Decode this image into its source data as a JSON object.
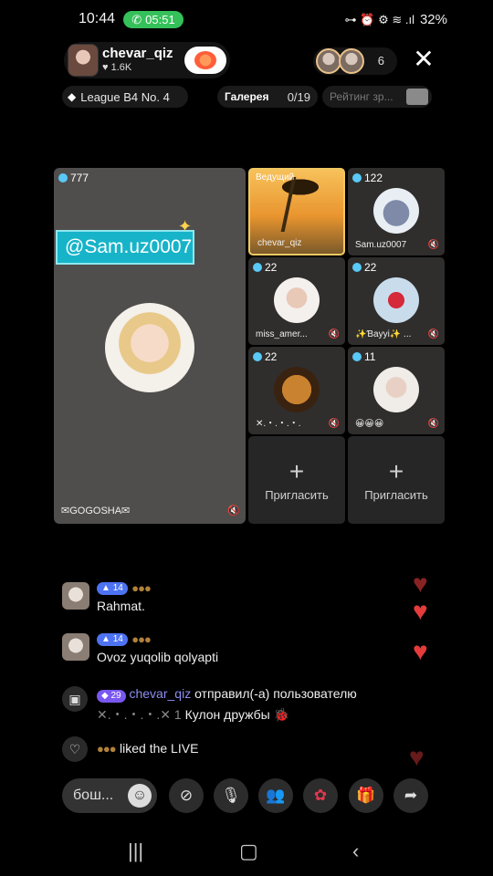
{
  "status_bar": {
    "time": "10:44",
    "call_timer": "05:51",
    "icons_text": "⊶ ⏰ ⚙ ≋ .ıl",
    "battery": "32%"
  },
  "host": {
    "name": "chevar_qiz",
    "fans": "1.6K"
  },
  "viewers": {
    "count": "6"
  },
  "league": {
    "label": "League B4 No. 4"
  },
  "gallery": {
    "label": "Галерея",
    "count": "0/19"
  },
  "rating": {
    "label": "Рейтинг зр..."
  },
  "grid": {
    "main": {
      "score": "777",
      "mention": "@Sam.uz0007",
      "name": "✉GOGOSHA✉"
    },
    "tiles": [
      {
        "label": "Ведущий",
        "name": "chevar_qiz",
        "score": ""
      },
      {
        "score": "122",
        "name": "Sam.uz0007"
      },
      {
        "score": "22",
        "name": "miss_amer..."
      },
      {
        "score": "22",
        "name": "✨Ɓayyi✨ ..."
      },
      {
        "score": "22",
        "name": "✕.・.・.・."
      },
      {
        "score": "11",
        "name": "😀😀😀"
      }
    ],
    "invite_label": "Пригласить"
  },
  "chat": [
    {
      "level": "14",
      "text": "Rahmat."
    },
    {
      "level": "14",
      "text": "Ovoz yuqolib qolyapti"
    }
  ],
  "gift": {
    "level": "29",
    "sender": "chevar_qiz",
    "text": "отправил(-а) пользователю",
    "recipient": "✕.・.・.・.✕ 1",
    "gift_name": "Кулон дружбы"
  },
  "liked": {
    "text": "liked the LIVE"
  },
  "bottom_bar": {
    "input_placeholder": "бош..."
  },
  "colors": {
    "accent_cyan": "#17b4c9",
    "heart": "#e43b3b",
    "call_green": "#35c15a",
    "level_blue": "#4d73f2",
    "level_purple": "#7a57f0"
  }
}
